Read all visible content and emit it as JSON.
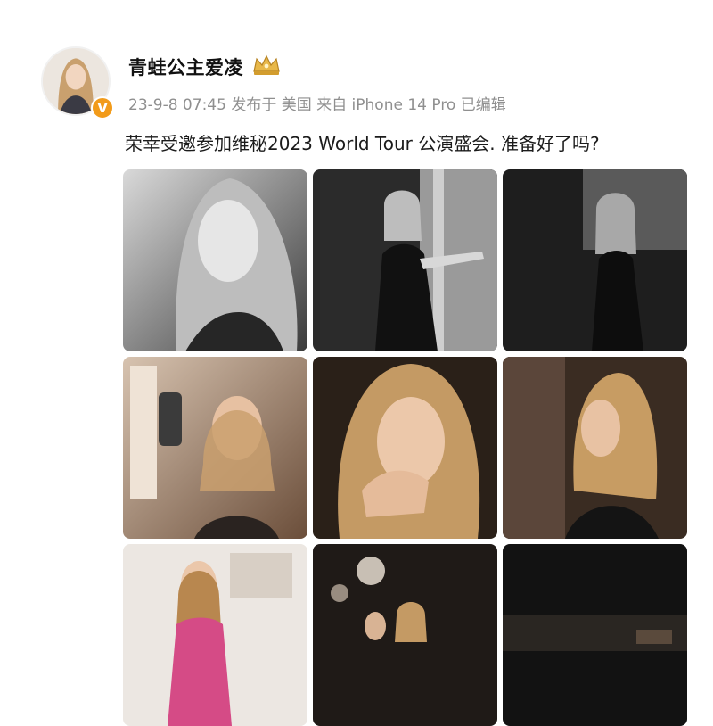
{
  "post": {
    "username": "青蛙公主爱凌",
    "meta": "23-9-8 07:45  发布于 美国  来自 iPhone 14 Pro 已编辑",
    "text": "荣幸受邀参加维秘2023 World Tour 公演盛会. 准备好了吗?",
    "badge_icon": "verified-v-icon",
    "crown_icon": "crown-icon",
    "accent": "#f29b1a"
  },
  "gallery": {
    "photos": [
      {
        "name": "bw-portrait-closeup",
        "tone": "bw"
      },
      {
        "name": "bw-black-dress-pose",
        "tone": "bw"
      },
      {
        "name": "bw-side-profile",
        "tone": "bw"
      },
      {
        "name": "hair-styling-backstage",
        "tone": "warm"
      },
      {
        "name": "chin-on-hand-portrait",
        "tone": "warm"
      },
      {
        "name": "profile-black-dress",
        "tone": "warm"
      },
      {
        "name": "pink-outfit-chandelier",
        "tone": "warm"
      },
      {
        "name": "backstage-group",
        "tone": "warm"
      },
      {
        "name": "dark-backstage",
        "tone": "warm"
      }
    ]
  }
}
